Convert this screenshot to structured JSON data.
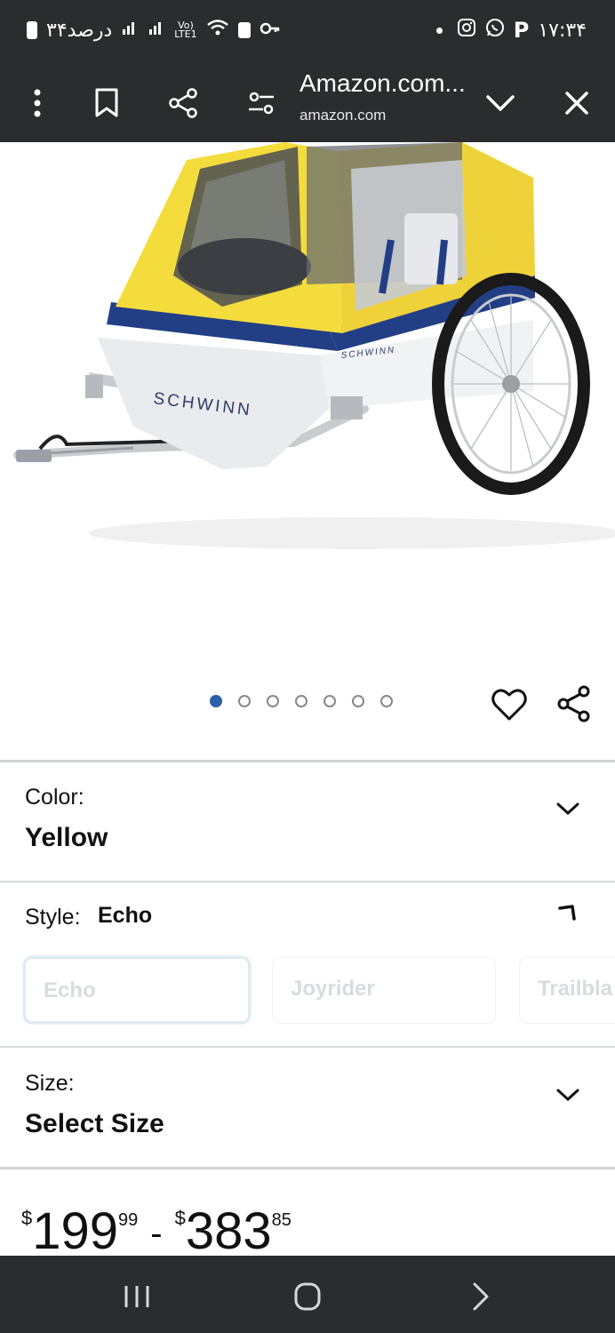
{
  "status_bar": {
    "left_text": "۳۴درصد",
    "right_time": "۱۷:۳۴"
  },
  "browser": {
    "title": "Amazon.com...",
    "domain": "amazon.com"
  },
  "product_image": {
    "brand_text": "SCHWINN",
    "brand_text_small": "SCHWINN",
    "carousel_count": 7,
    "carousel_active_index": 0
  },
  "color_section": {
    "label": "Color:",
    "value": "Yellow"
  },
  "style_section": {
    "label": "Style:",
    "value": "Echo",
    "options": [
      "Echo",
      "Joyrider",
      "Trailbla"
    ]
  },
  "size_section": {
    "label": "Size:",
    "value": "Select Size"
  },
  "price": {
    "low_symbol": "$",
    "low_whole": "199",
    "low_fraction": "99",
    "separator": "-",
    "high_symbol": "$",
    "high_whole": "383",
    "high_fraction": "85"
  },
  "colors": {
    "chrome": "#2b2c2e",
    "canopy_yellow": "#f3dc3c",
    "trim_navy": "#223f86",
    "active_dot": "#2d5ea8"
  }
}
